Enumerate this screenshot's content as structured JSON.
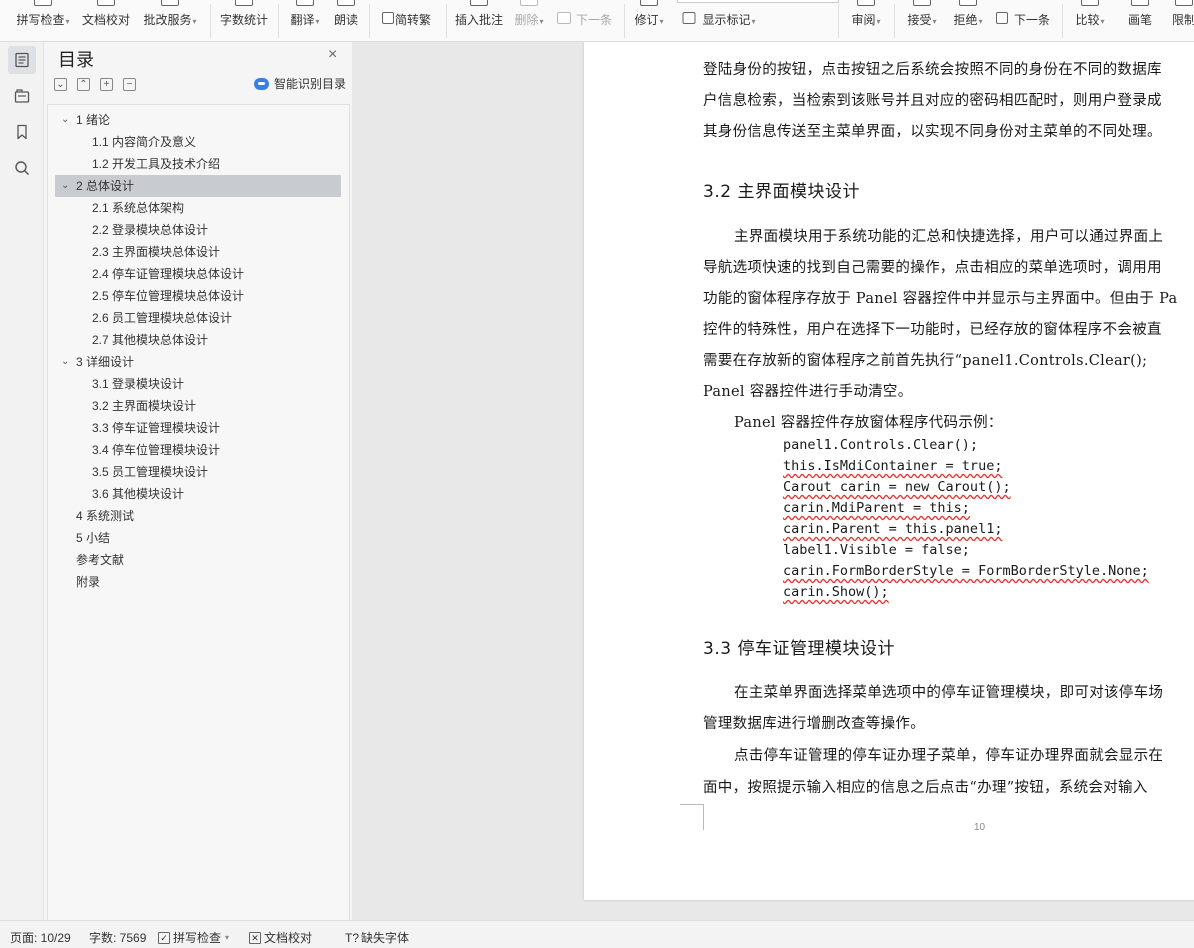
{
  "ribbon": {
    "buttons": [
      {
        "label": "拼写检查",
        "caret": "▾"
      },
      {
        "label": "文档校对"
      },
      {
        "label": "批改服务",
        "caret": "▾"
      },
      {
        "label": "字数统计"
      },
      {
        "label": "翻译",
        "caret": "▾"
      },
      {
        "label": "朗读"
      },
      {
        "label": "简转繁"
      },
      {
        "label": "插入批注"
      },
      {
        "label": "删除",
        "caret": "▾"
      },
      {
        "label": "下一条"
      },
      {
        "label": "修订",
        "caret": "▾"
      },
      {
        "label": "显示标记",
        "caret": "▾"
      },
      {
        "label": "审阅",
        "caret": "▾"
      },
      {
        "label": "接受",
        "caret": "▾"
      },
      {
        "label": "拒绝",
        "caret": "▾"
      },
      {
        "label": "下一条"
      },
      {
        "label": "比较",
        "caret": "▾"
      },
      {
        "label": "画笔"
      },
      {
        "label": "限制"
      }
    ]
  },
  "toc": {
    "title": "目录",
    "close": "×",
    "tools": [
      "⌄",
      "⌃",
      "+",
      "−"
    ],
    "smart_label": "智能识别目录",
    "items": [
      {
        "toggle": "⌄",
        "label": "1 绪论"
      },
      {
        "label": "1.1 内容简介及意义"
      },
      {
        "label": "1.2 开发工具及技术介绍"
      },
      {
        "toggle": "⌄",
        "label": "2 总体设计"
      },
      {
        "label": "2.1 系统总体架构"
      },
      {
        "label": "2.2 登录模块总体设计"
      },
      {
        "label": "2.3 主界面模块总体设计"
      },
      {
        "label": "2.4 停车证管理模块总体设计"
      },
      {
        "label": "2.5 停车位管理模块总体设计"
      },
      {
        "label": "2.6 员工管理模块总体设计"
      },
      {
        "label": "2.7 其他模块总体设计"
      },
      {
        "toggle": "⌄",
        "label": "3 详细设计"
      },
      {
        "label": "3.1 登录模块设计"
      },
      {
        "label": "3.2 主界面模块设计"
      },
      {
        "label": "3.3 停车证管理模块设计"
      },
      {
        "label": "3.4 停车位管理模块设计"
      },
      {
        "label": "3.5 员工管理模块设计"
      },
      {
        "label": "3.6 其他模块设计"
      },
      {
        "label": "4 系统测试"
      },
      {
        "label": "5 小结"
      },
      {
        "label": "参考文献"
      },
      {
        "label": "附录"
      }
    ]
  },
  "document": {
    "lines": [
      "登陆身份的按钮，点击按钮之后系统会按照不同的身份在不同的数据库",
      "户信息检索，当检索到该账号并且对应的密码相匹配时，则用户登录成",
      "其身份信息传送至主菜单界面，以实现不同身份对主菜单的不同处理。",
      "主界面模块用于系统功能的汇总和快捷选择，用户可以通过界面上",
      "导航选项快速的找到自己需要的操作，点击相应的菜单选项时，调用用",
      "功能的窗体程序存放于 Panel 容器控件中并显示与主界面中。但由于 Pa",
      "控件的特殊性，用户在选择下一功能时，已经存放的窗体程序不会被直",
      "需要在存放新的窗体程序之前首先执行“panel1.Controls.Clear();",
      "Panel 容器控件进行手动清空。",
      "Panel 容器控件存放窗体程序代码示例：",
      "在主菜单界面选择菜单选项中的停车证管理模块，即可对该停车场",
      "管理数据库进行增删改查等操作。",
      "点击停车证管理的停车证办理子菜单，停车证办理界面就会显示在",
      "面中，按照提示输入相应的信息之后点击“办理”按钮，系统会对输入"
    ],
    "heading_1": "3.2 主界面模块设计",
    "heading_2": "3.3 停车证管理模块设计",
    "code": [
      "panel1.Controls.Clear();",
      "this.IsMdiContainer = true;",
      "Carout carin = new Carout();",
      "carin.MdiParent = this;",
      "carin.Parent = this.panel1;",
      "label1.Visible = false;",
      "carin.FormBorderStyle = FormBorderStyle.None;",
      "carin.Show();"
    ],
    "page_number": "10"
  },
  "status": {
    "page": "页面: 10/29",
    "words": "字数: 7569",
    "spell": "拼写检查",
    "proof": "文档校对",
    "missing_font": "缺失字体",
    "caret": "▾"
  }
}
